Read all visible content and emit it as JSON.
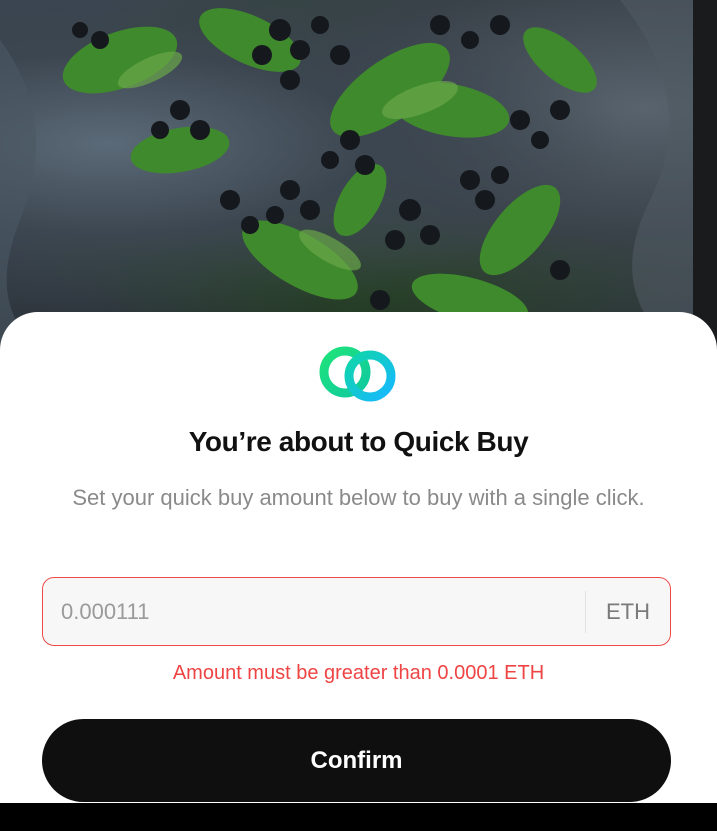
{
  "background": {
    "image": "green-leaves-dark-berries-photo"
  },
  "quick_buy_sheet": {
    "logo_icon": "quick-buy-rings-icon",
    "title": "You’re about to Quick Buy",
    "subtitle": "Set your quick buy amount below to buy with a single click.",
    "amount": {
      "value": "0.000111",
      "currency": "ETH"
    },
    "error_message": "Amount must be greater than 0.0001 ETH",
    "confirm_label": "Confirm"
  },
  "colors": {
    "error": "#ef4444",
    "button_bg": "#0f0f10",
    "logo_gradient_start": "#1ee3a0",
    "logo_gradient_end": "#16b8ff"
  }
}
